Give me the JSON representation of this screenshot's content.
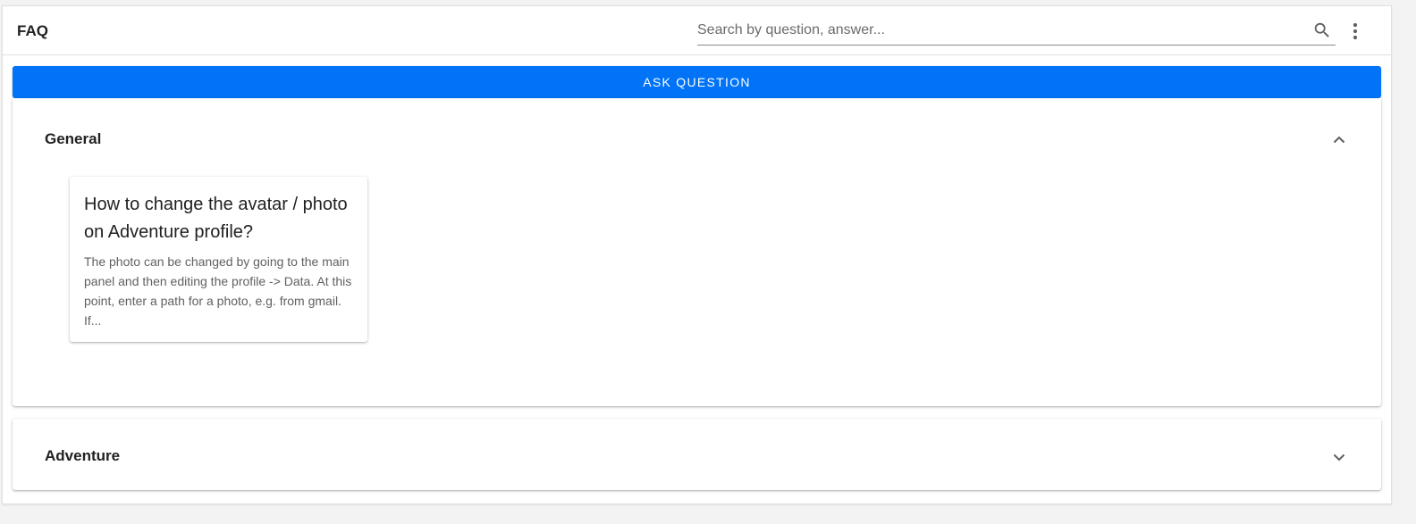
{
  "header": {
    "title": "FAQ",
    "search": {
      "placeholder": "Search by question, answer...",
      "value": ""
    },
    "search_icon": "search-icon",
    "menu_icon": "more-vert-icon"
  },
  "ask_button": {
    "label": "Ask question",
    "color": "#0073f7"
  },
  "sections": [
    {
      "title": "General",
      "expanded": true,
      "toggle_icon": "chevron-up-icon",
      "items": [
        {
          "question": "How to change the avatar / photo on Adventure profile?",
          "answer_excerpt": "The photo can be changed by going to the main panel and then editing the profile -> Data. At this point, enter a path for a photo, e.g. from gmail. If..."
        }
      ]
    },
    {
      "title": "Adventure",
      "expanded": false,
      "toggle_icon": "chevron-down-icon",
      "items": []
    }
  ]
}
